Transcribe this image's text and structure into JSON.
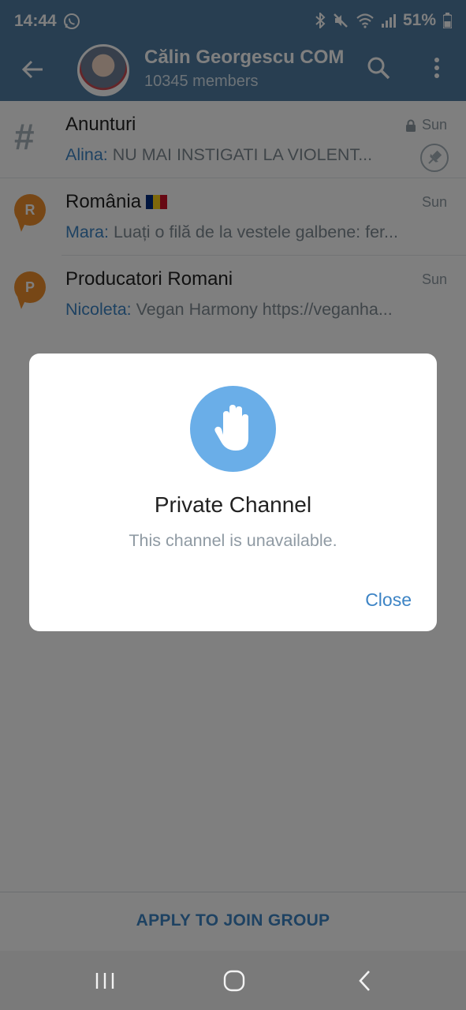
{
  "status_bar": {
    "time": "14:44",
    "battery": "51%",
    "icons": [
      "whatsapp-icon",
      "bluetooth-icon",
      "mute-icon",
      "wifi-icon",
      "signal-icon",
      "battery-icon"
    ]
  },
  "header": {
    "title": "Călin Georgescu COM",
    "members": "10345 members"
  },
  "chats": [
    {
      "title": "Anunturi",
      "date": "Sun",
      "sender": "Alina:",
      "message": "NU MAI INSTIGATI LA VIOLENT...",
      "icon": "hash-icon",
      "locked": true,
      "pinned": true
    },
    {
      "title": "România",
      "date": "Sun",
      "sender": "Mara:",
      "message": "Luați o filă de la vestele galbene: fer...",
      "icon": "chat-bubble-icon",
      "badge": "R",
      "flag": "romania-flag-icon"
    },
    {
      "title": "Producatori Romani",
      "date": "Sun",
      "sender": "Nicoleta:",
      "message": "Vegan Harmony https://veganha...",
      "icon": "chat-bubble-icon",
      "badge": "P"
    }
  ],
  "dialog": {
    "title": "Private Channel",
    "subtitle": "This channel is unavailable.",
    "close_label": "Close",
    "icon": "raised-hand-icon"
  },
  "bottom_action": "APPLY TO JOIN GROUP",
  "colors": {
    "header": "#517da2",
    "accent": "#3d84c5",
    "hand_circle": "#6aaee8",
    "badge_orange": "#ee8e2c",
    "flag": [
      "#002b7f",
      "#fcd116",
      "#ce1126"
    ]
  }
}
